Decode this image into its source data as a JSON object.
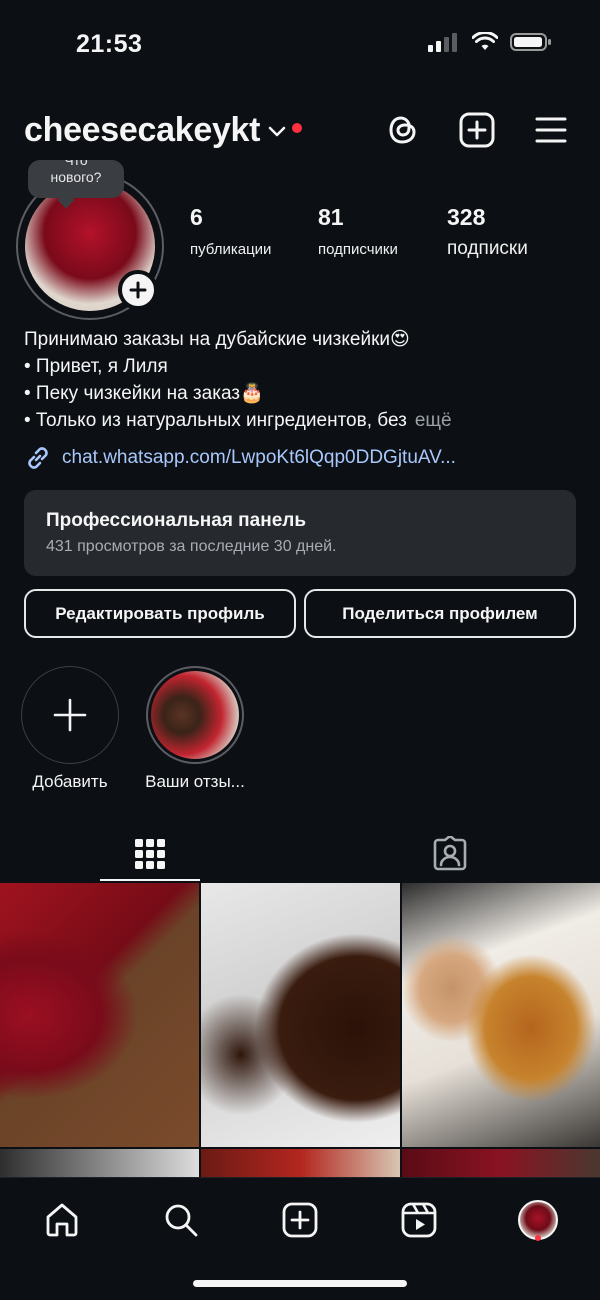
{
  "status_bar": {
    "time": "21:53"
  },
  "header": {
    "username": "cheesecakeykt"
  },
  "profile": {
    "note_text_line1": "Что",
    "note_text_line2": "нового?",
    "stats": [
      {
        "value": "6",
        "label": "публикации"
      },
      {
        "value": "81",
        "label": "подписчики"
      },
      {
        "value": "328",
        "label": "подписки"
      }
    ]
  },
  "bio": {
    "line1": "Принимаю заказы на дубайские чизкейки😍",
    "line2": "• Привет, я Лиля",
    "line3": "• Пеку чизкейки на заказ🎂",
    "line4": "• Только из натуральных ингредиентов, без",
    "more": "ещё",
    "link": "chat.whatsapp.com/LwpoKt6lQqp0DDGjtuAV..."
  },
  "pro_dashboard": {
    "title": "Профессиональная панель",
    "subtitle": "431 просмотров за последние 30 дней."
  },
  "buttons": {
    "edit_profile": "Редактировать профиль",
    "share_profile": "Поделиться профилем"
  },
  "highlights": [
    {
      "label": "Добавить"
    },
    {
      "label": "Ваши отзы..."
    }
  ],
  "colors": {
    "background": "#0c1014",
    "link": "#a8c7fa",
    "notification_dot": "#ff3040",
    "panel": "#262a2f"
  },
  "icons": [
    "chevron-down-icon",
    "threads-icon",
    "new-post-icon",
    "menu-icon",
    "link-icon",
    "grid-icon",
    "tagged-icon",
    "home-icon",
    "search-icon",
    "create-icon",
    "reels-icon"
  ]
}
